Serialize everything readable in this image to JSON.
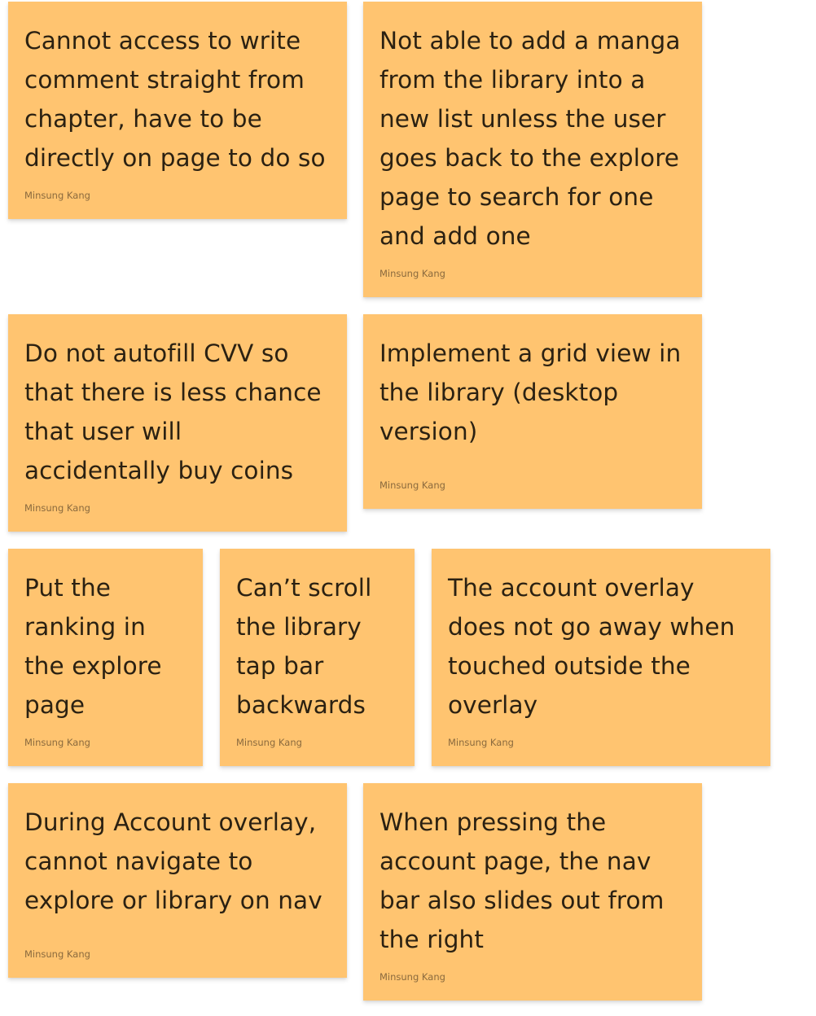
{
  "notes": [
    {
      "text": "Cannot access to write\ncomment straight from\nchapter, have to be\ndirectly on page to do so",
      "author": "Minsung Kang"
    },
    {
      "text": "Not able to add a manga\nfrom the library into a\nnew list unless the user\ngoes back to the explore\npage to search for one\nand add one",
      "author": "Minsung Kang"
    },
    {
      "text": "Do not autofill CVV so\nthat there is less chance\nthat user will\naccidentally buy coins",
      "author": "Minsung Kang"
    },
    {
      "text": "Implement a grid view in\nthe library (desktop\nversion)",
      "author": "Minsung Kang"
    },
    {
      "text": "Put the\nranking in\nthe explore\npage",
      "author": "Minsung Kang"
    },
    {
      "text": "Can’t scroll\nthe library\ntap bar\nbackwards",
      "author": "Minsung Kang"
    },
    {
      "text": "The account overlay\ndoes not go away when\ntouched outside the\noverlay",
      "author": "Minsung Kang"
    },
    {
      "text": "During Account overlay,\ncannot navigate to\nexplore or library on nav",
      "author": "Minsung Kang"
    },
    {
      "text": "When pressing the\naccount page, the nav\nbar also slides out from\nthe right",
      "author": "Minsung Kang"
    }
  ]
}
